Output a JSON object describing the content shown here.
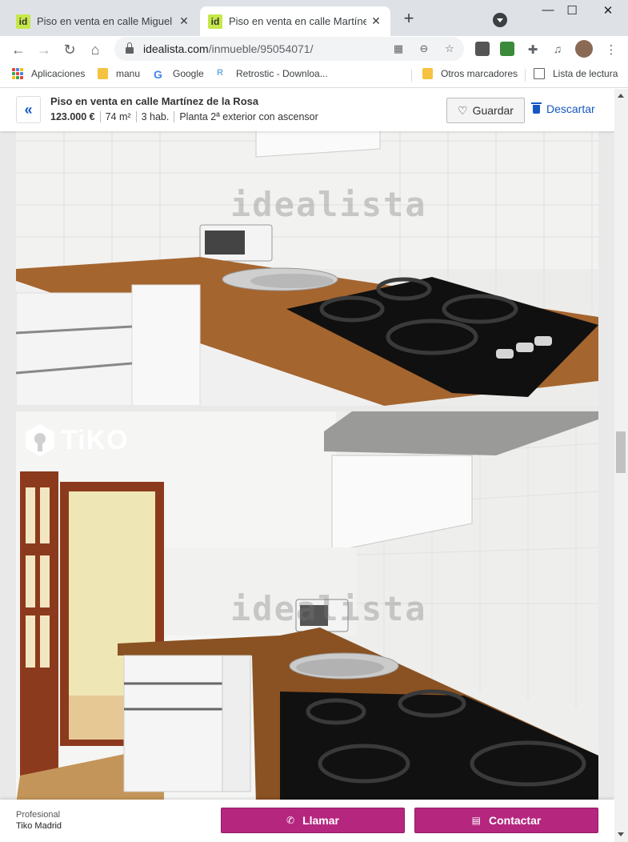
{
  "browser": {
    "tabs": [
      {
        "favicon": "id",
        "title": "Piso en venta en calle Miguel Mo",
        "active": false
      },
      {
        "favicon": "id",
        "title": "Piso en venta en calle Martínez d",
        "active": true
      }
    ],
    "new_tab_icon": "+",
    "window_controls": {
      "minimize": "—",
      "maximize": "☐",
      "close": "✕"
    },
    "url_host": "idealista.com",
    "url_path": "/inmueble/95054071/",
    "bookmarks": [
      {
        "label": "Aplicaciones",
        "icon": "apps-grid-icon"
      },
      {
        "label": "manu",
        "icon": "folder-icon"
      },
      {
        "label": "Google",
        "icon": "google-icon"
      },
      {
        "label": "Retrostic - Downloa...",
        "icon": "retrostic-icon"
      },
      {
        "label": "Otros marcadores",
        "icon": "folder-icon"
      },
      {
        "label": "Lista de lectura",
        "icon": "reading-list-icon"
      }
    ]
  },
  "listing": {
    "title": "Piso en venta en calle Martínez de la Rosa",
    "price": "123.000 €",
    "area": "74 m²",
    "rooms": "3 hab.",
    "floor": "Planta 2ª exterior con ascensor",
    "save_label": "Guardar",
    "discard_label": "Descartar"
  },
  "photos": {
    "watermark": "idealista",
    "agency_logo": "TiKO"
  },
  "contact": {
    "agent_type": "Profesional",
    "agent_name": "Tiko Madrid",
    "call_label": "Llamar",
    "contact_label": "Contactar"
  },
  "colors": {
    "brand_accent": "#b5267f",
    "link_blue": "#1558c4",
    "favicon_green": "#c5e84a"
  }
}
